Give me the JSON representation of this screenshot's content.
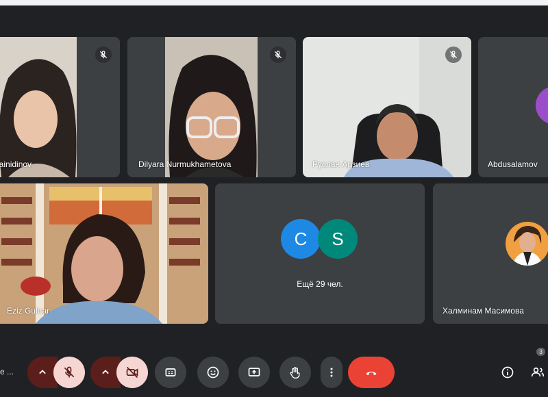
{
  "participants": {
    "p1": {
      "name": "Zhainidinova",
      "name_visible": "hainidinov"
    },
    "p2": {
      "name": "Dilyara Nurmukhametova"
    },
    "p3": {
      "name": "Руслан Арзиев"
    },
    "p4": {
      "name": "Abdusalamov"
    },
    "p5": {
      "name": "Eziz Gulnar"
    },
    "p6": {
      "name": "Халминам Масимова"
    }
  },
  "others_tile": {
    "avatars": [
      {
        "letter": "C",
        "color": "#1e88e5"
      },
      {
        "letter": "S",
        "color": "#00897b"
      }
    ],
    "more_label": "Ещё 29 чел."
  },
  "toolbar": {
    "left_text": "e ...",
    "people_count": "3",
    "icons": [
      "chevron-up-icon",
      "mic-off-icon",
      "chevron-up-icon",
      "camera-off-icon",
      "captions-icon",
      "emoji-icon",
      "present-screen-icon",
      "raise-hand-icon",
      "more-vert-icon",
      "end-call-icon",
      "info-icon",
      "people-icon"
    ]
  },
  "colors": {
    "background": "#202124",
    "tile": "#3c4043",
    "end_call": "#ea4335",
    "muted_button": "#f6d6d2",
    "muted_caret": "#5c1e1a"
  }
}
